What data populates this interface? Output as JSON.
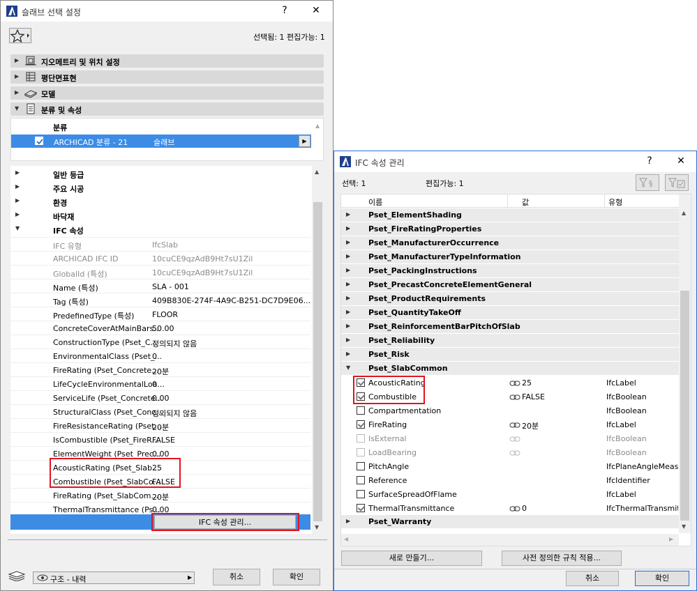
{
  "win1": {
    "title": "슬래브 선택 설정",
    "help": "?",
    "close": "✕",
    "selection_info": "선택됨: 1 편집가능: 1",
    "panels": [
      {
        "label": "지오메트리 및 위치 설정",
        "icon": "geometry-icon"
      },
      {
        "label": "평단면표현",
        "icon": "floorplan-icon"
      },
      {
        "label": "모델",
        "icon": "model-icon"
      },
      {
        "label": "분류 및 속성",
        "icon": "classification-icon"
      }
    ],
    "classification": {
      "header": "분류",
      "row_system": "ARCHICAD 분류 - 21",
      "row_value": "슬래브"
    },
    "groups": [
      "일반 등급",
      "주요 시공",
      "환경",
      "바닥재",
      "IFC 속성"
    ],
    "ifc_rows": [
      {
        "name": "IFC 유형",
        "value": "IfcSlab",
        "dim": true
      },
      {
        "name": "ARCHICAD IFC ID",
        "value": "10cuCE9qzAdB9Ht7sU1Zil",
        "dim": true
      },
      {
        "name": "GlobalId (특성)",
        "value": "10cuCE9qzAdB9Ht7sU1Zil",
        "dim": true
      },
      {
        "name": "Name (특성)",
        "value": "SLA - 001",
        "dim": false
      },
      {
        "name": "Tag (특성)",
        "value": "409B830E-274F-4A9C-B251-DC7D9E06...",
        "dim": false
      },
      {
        "name": "PredefinedType (특성)",
        "value": "FLOOR",
        "dim": false
      },
      {
        "name": "ConcreteCoverAtMainBars...",
        "value": "50.00",
        "dim": false
      },
      {
        "name": "ConstructionType (Pset_C...",
        "value": "정의되지 않음",
        "dim": false
      },
      {
        "name": "EnvironmentalClass (Pset_...",
        "value": "0",
        "dim": false
      },
      {
        "name": "FireRating (Pset_Concrete...",
        "value": "20분",
        "dim": false
      },
      {
        "name": "LifeCycleEnvironmentalLoa...",
        "value": "0",
        "dim": false
      },
      {
        "name": "ServiceLife (Pset_Concrete...",
        "value": "0.00",
        "dim": false
      },
      {
        "name": "StructuralClass (Pset_Conc...",
        "value": "정의되지 않음",
        "dim": false
      },
      {
        "name": "FireResistanceRating (Pset...",
        "value": "20분",
        "dim": false
      },
      {
        "name": "IsCombustible (Pset_FireR...",
        "value": "FALSE",
        "dim": false
      },
      {
        "name": "ElementWeight (Pset_Prec...",
        "value": "0.00",
        "dim": false
      },
      {
        "name": "AcousticRating (Pset_Slab...",
        "value": "25",
        "dim": false
      },
      {
        "name": "Combustible (Pset_SlabCo...",
        "value": "FALSE",
        "dim": false
      },
      {
        "name": "FireRating (Pset_SlabCom...",
        "value": "20분",
        "dim": false
      },
      {
        "name": "ThermalTransmittance (Ps...",
        "value": "0.00",
        "dim": false
      }
    ],
    "manage_button": "IFC 속성 관리...",
    "view_select": "구조 - 내력",
    "cancel": "취소",
    "ok": "확인"
  },
  "win2": {
    "title": "IFC 속성 관리",
    "help": "?",
    "close": "✕",
    "selection": "선택: 1",
    "editable": "편집가능: 1",
    "columns": {
      "name": "이름",
      "value": "값",
      "type": "유형"
    },
    "psets_before": [
      "Pset_ElementShading",
      "Pset_FireRatingProperties",
      "Pset_ManufacturerOccurrence",
      "Pset_ManufacturerTypeInformation",
      "Pset_PackingInstructions",
      "Pset_PrecastConcreteElementGeneral",
      "Pset_ProductRequirements",
      "Pset_QuantityTakeOff",
      "Pset_ReinforcementBarPitchOfSlab",
      "Pset_Reliability",
      "Pset_Risk",
      "Pset_SlabCommon"
    ],
    "props": [
      {
        "name": "AcousticRating",
        "value": "25",
        "type": "IfcLabel",
        "checked": true,
        "disabled": false,
        "link": true
      },
      {
        "name": "Combustible",
        "value": "FALSE",
        "type": "IfcBoolean",
        "checked": true,
        "disabled": false,
        "link": true
      },
      {
        "name": "Compartmentation",
        "value": "",
        "type": "IfcBoolean",
        "checked": false,
        "disabled": false,
        "link": false
      },
      {
        "name": "FireRating",
        "value": "20분",
        "type": "IfcLabel",
        "checked": true,
        "disabled": false,
        "link": true
      },
      {
        "name": "IsExternal",
        "value": "",
        "type": "IfcBoolean",
        "checked": false,
        "disabled": true,
        "link": true
      },
      {
        "name": "LoadBearing",
        "value": "",
        "type": "IfcBoolean",
        "checked": false,
        "disabled": true,
        "link": true
      },
      {
        "name": "PitchAngle",
        "value": "",
        "type": "IfcPlaneAngleMeasu",
        "checked": false,
        "disabled": false,
        "link": false
      },
      {
        "name": "Reference",
        "value": "",
        "type": "IfcIdentifier",
        "checked": false,
        "disabled": false,
        "link": false
      },
      {
        "name": "SurfaceSpreadOfFlame",
        "value": "",
        "type": "IfcLabel",
        "checked": false,
        "disabled": false,
        "link": false
      },
      {
        "name": "ThermalTransmittance",
        "value": "0",
        "type": "IfcThermalTransmitt",
        "checked": true,
        "disabled": false,
        "link": true
      }
    ],
    "pset_after": "Pset_Warranty",
    "new_button": "새로 만들기...",
    "rules_button": "사전 정의한 규칙 적용...",
    "cancel": "취소",
    "ok": "확인"
  }
}
